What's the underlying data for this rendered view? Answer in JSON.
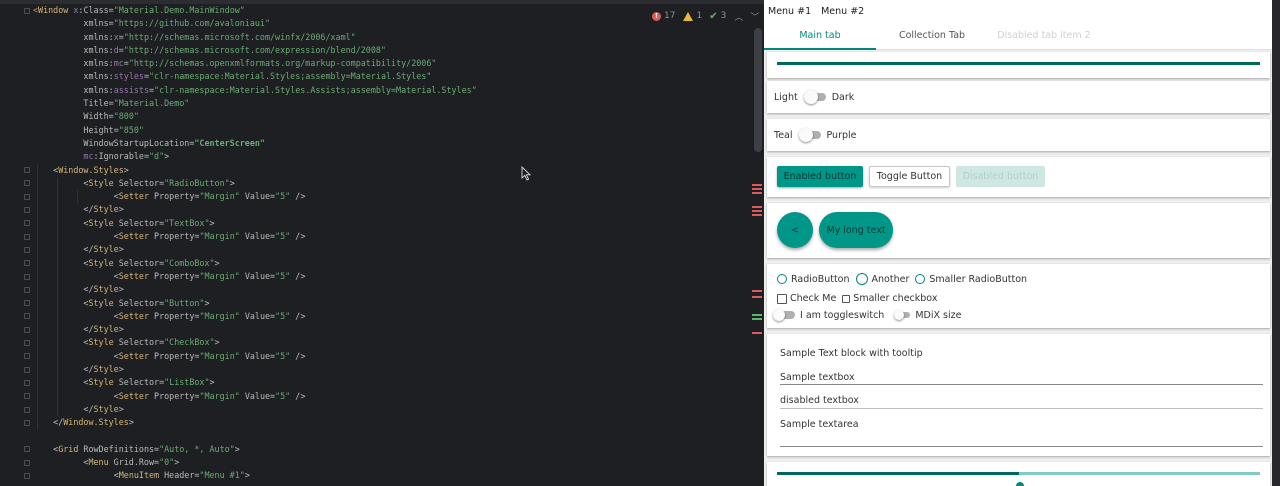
{
  "editor": {
    "inspections": {
      "errors": "17",
      "warnings": "1",
      "ok": "3"
    },
    "code_lines": [
      {
        "indent": 0,
        "parts": [
          [
            "caret",
            "<"
          ],
          [
            "c-tag",
            "Window"
          ],
          [
            "c-ns",
            " x"
          ],
          [
            "c-punc",
            ":"
          ],
          [
            "c-attr",
            "Class"
          ],
          [
            "c-punc",
            "="
          ],
          [
            "c-str",
            "\"Material.Demo.MainWindow\""
          ]
        ]
      },
      {
        "indent": 5,
        "parts": [
          [
            "c-attr",
            "xmlns"
          ],
          [
            "c-punc",
            "="
          ],
          [
            "c-str",
            "\"https://github.com/avaloniaui\""
          ]
        ]
      },
      {
        "indent": 5,
        "parts": [
          [
            "c-attr",
            "xmlns"
          ],
          [
            "c-punc",
            ":"
          ],
          [
            "c-ns",
            "x"
          ],
          [
            "c-punc",
            "="
          ],
          [
            "c-str",
            "\"http://schemas.microsoft.com/winfx/2006/xaml\""
          ]
        ]
      },
      {
        "indent": 5,
        "parts": [
          [
            "c-attr",
            "xmlns"
          ],
          [
            "c-punc",
            ":"
          ],
          [
            "c-ns",
            "d"
          ],
          [
            "c-punc",
            "="
          ],
          [
            "c-str",
            "\"http://schemas.microsoft.com/expression/blend/2008\""
          ]
        ]
      },
      {
        "indent": 5,
        "parts": [
          [
            "c-attr",
            "xmlns"
          ],
          [
            "c-punc",
            ":"
          ],
          [
            "c-ns",
            "mc"
          ],
          [
            "c-punc",
            "="
          ],
          [
            "c-str",
            "\"http://schemas.openxmlformats.org/markup-compatibility/2006\""
          ]
        ]
      },
      {
        "indent": 5,
        "parts": [
          [
            "c-attr",
            "xmlns"
          ],
          [
            "c-punc",
            ":"
          ],
          [
            "c-ns",
            "styles"
          ],
          [
            "c-punc",
            "="
          ],
          [
            "c-str",
            "\"clr-namespace:Material.Styles;assembly=Material.Styles\""
          ]
        ]
      },
      {
        "indent": 5,
        "parts": [
          [
            "c-attr",
            "xmlns"
          ],
          [
            "c-punc",
            ":"
          ],
          [
            "c-ns",
            "assists"
          ],
          [
            "c-punc",
            "="
          ],
          [
            "c-str",
            "\"clr-namespace:Material.Styles.Assists;assembly=Material.Styles\""
          ]
        ]
      },
      {
        "indent": 5,
        "parts": [
          [
            "c-attr",
            "Title"
          ],
          [
            "c-punc",
            "="
          ],
          [
            "c-str",
            "\"Material.Demo\""
          ]
        ]
      },
      {
        "indent": 5,
        "parts": [
          [
            "c-attr",
            "Width"
          ],
          [
            "c-punc",
            "="
          ],
          [
            "c-str",
            "\"800\""
          ]
        ]
      },
      {
        "indent": 5,
        "parts": [
          [
            "c-attr",
            "Height"
          ],
          [
            "c-punc",
            "="
          ],
          [
            "c-str",
            "\"850\""
          ]
        ]
      },
      {
        "indent": 5,
        "parts": [
          [
            "c-attr",
            "WindowStartupLocation"
          ],
          [
            "c-punc",
            "="
          ],
          [
            "c-strb",
            "\"CenterScreen\""
          ]
        ]
      },
      {
        "indent": 5,
        "parts": [
          [
            "c-ns",
            "mc"
          ],
          [
            "c-punc",
            ":"
          ],
          [
            "c-attr",
            "Ignorable"
          ],
          [
            "c-punc",
            "="
          ],
          [
            "c-str",
            "\"d\""
          ],
          [
            "c-punc",
            ">"
          ]
        ]
      },
      {
        "indent": 2,
        "parts": [
          [
            "c-punc",
            "<"
          ],
          [
            "c-tag",
            "Window.Styles"
          ],
          [
            "c-punc",
            ">"
          ]
        ]
      },
      {
        "indent": 5,
        "parts": [
          [
            "c-punc",
            "<"
          ],
          [
            "c-tag",
            "Style"
          ],
          [
            "c-attr",
            " Selector"
          ],
          [
            "c-punc",
            "="
          ],
          [
            "c-str",
            "\"RadioButton\""
          ],
          [
            "c-punc",
            ">"
          ]
        ]
      },
      {
        "indent": 8,
        "parts": [
          [
            "c-punc",
            "<"
          ],
          [
            "c-tag",
            "Setter"
          ],
          [
            "c-attr",
            " Property"
          ],
          [
            "c-punc",
            "="
          ],
          [
            "c-str",
            "\"Margin\""
          ],
          [
            "c-attr",
            " Value"
          ],
          [
            "c-punc",
            "="
          ],
          [
            "c-str",
            "\"5\""
          ],
          [
            "c-punc",
            " />"
          ]
        ]
      },
      {
        "indent": 5,
        "parts": [
          [
            "c-punc",
            "</"
          ],
          [
            "c-tag",
            "Style"
          ],
          [
            "c-punc",
            ">"
          ]
        ]
      },
      {
        "indent": 5,
        "parts": [
          [
            "c-punc",
            "<"
          ],
          [
            "c-tag",
            "Style"
          ],
          [
            "c-attr",
            " Selector"
          ],
          [
            "c-punc",
            "="
          ],
          [
            "c-str",
            "\"TextBox\""
          ],
          [
            "c-punc",
            ">"
          ]
        ]
      },
      {
        "indent": 8,
        "parts": [
          [
            "c-punc",
            "<"
          ],
          [
            "c-tag",
            "Setter"
          ],
          [
            "c-attr",
            " Property"
          ],
          [
            "c-punc",
            "="
          ],
          [
            "c-str",
            "\"Margin\""
          ],
          [
            "c-attr",
            " Value"
          ],
          [
            "c-punc",
            "="
          ],
          [
            "c-str",
            "\"5\""
          ],
          [
            "c-punc",
            " />"
          ]
        ]
      },
      {
        "indent": 5,
        "parts": [
          [
            "c-punc",
            "</"
          ],
          [
            "c-tag",
            "Style"
          ],
          [
            "c-punc",
            ">"
          ]
        ]
      },
      {
        "indent": 5,
        "parts": [
          [
            "c-punc",
            "<"
          ],
          [
            "c-tag",
            "Style"
          ],
          [
            "c-attr",
            " Selector"
          ],
          [
            "c-punc",
            "="
          ],
          [
            "c-str",
            "\"ComboBox\""
          ],
          [
            "c-punc",
            ">"
          ]
        ]
      },
      {
        "indent": 8,
        "parts": [
          [
            "c-punc",
            "<"
          ],
          [
            "c-tag",
            "Setter"
          ],
          [
            "c-attr",
            " Property"
          ],
          [
            "c-punc",
            "="
          ],
          [
            "c-str",
            "\"Margin\""
          ],
          [
            "c-attr",
            " Value"
          ],
          [
            "c-punc",
            "="
          ],
          [
            "c-str",
            "\"5\""
          ],
          [
            "c-punc",
            " />"
          ]
        ]
      },
      {
        "indent": 5,
        "parts": [
          [
            "c-punc",
            "</"
          ],
          [
            "c-tag",
            "Style"
          ],
          [
            "c-punc",
            ">"
          ]
        ]
      },
      {
        "indent": 5,
        "parts": [
          [
            "c-punc",
            "<"
          ],
          [
            "c-tag",
            "Style"
          ],
          [
            "c-attr",
            " Selector"
          ],
          [
            "c-punc",
            "="
          ],
          [
            "c-str",
            "\"Button\""
          ],
          [
            "c-punc",
            ">"
          ]
        ]
      },
      {
        "indent": 8,
        "parts": [
          [
            "c-punc",
            "<"
          ],
          [
            "c-tag",
            "Setter"
          ],
          [
            "c-attr",
            " Property"
          ],
          [
            "c-punc",
            "="
          ],
          [
            "c-str",
            "\"Margin\""
          ],
          [
            "c-attr",
            " Value"
          ],
          [
            "c-punc",
            "="
          ],
          [
            "c-str",
            "\"5\""
          ],
          [
            "c-punc",
            " />"
          ]
        ]
      },
      {
        "indent": 5,
        "parts": [
          [
            "c-punc",
            "</"
          ],
          [
            "c-tag",
            "Style"
          ],
          [
            "c-punc",
            ">"
          ]
        ]
      },
      {
        "indent": 5,
        "parts": [
          [
            "c-punc",
            "<"
          ],
          [
            "c-tag",
            "Style"
          ],
          [
            "c-attr",
            " Selector"
          ],
          [
            "c-punc",
            "="
          ],
          [
            "c-str",
            "\"CheckBox\""
          ],
          [
            "c-punc",
            ">"
          ]
        ]
      },
      {
        "indent": 8,
        "parts": [
          [
            "c-punc",
            "<"
          ],
          [
            "c-tag",
            "Setter"
          ],
          [
            "c-attr",
            " Property"
          ],
          [
            "c-punc",
            "="
          ],
          [
            "c-str",
            "\"Margin\""
          ],
          [
            "c-attr",
            " Value"
          ],
          [
            "c-punc",
            "="
          ],
          [
            "c-str",
            "\"5\""
          ],
          [
            "c-punc",
            " />"
          ]
        ]
      },
      {
        "indent": 5,
        "parts": [
          [
            "c-punc",
            "</"
          ],
          [
            "c-tag",
            "Style"
          ],
          [
            "c-punc",
            ">"
          ]
        ]
      },
      {
        "indent": 5,
        "parts": [
          [
            "c-punc",
            "<"
          ],
          [
            "c-tag",
            "Style"
          ],
          [
            "c-attr",
            " Selector"
          ],
          [
            "c-punc",
            "="
          ],
          [
            "c-str",
            "\"ListBox\""
          ],
          [
            "c-punc",
            ">"
          ]
        ]
      },
      {
        "indent": 8,
        "parts": [
          [
            "c-punc",
            "<"
          ],
          [
            "c-tag",
            "Setter"
          ],
          [
            "c-attr",
            " Property"
          ],
          [
            "c-punc",
            "="
          ],
          [
            "c-str",
            "\"Margin\""
          ],
          [
            "c-attr",
            " Value"
          ],
          [
            "c-punc",
            "="
          ],
          [
            "c-str",
            "\"5\""
          ],
          [
            "c-punc",
            " />"
          ]
        ]
      },
      {
        "indent": 5,
        "parts": [
          [
            "c-punc",
            "</"
          ],
          [
            "c-tag",
            "Style"
          ],
          [
            "c-punc",
            ">"
          ]
        ]
      },
      {
        "indent": 2,
        "parts": [
          [
            "c-punc",
            "</"
          ],
          [
            "c-tag",
            "Window.Styles"
          ],
          [
            "c-punc",
            ">"
          ]
        ]
      },
      {
        "indent": 0,
        "parts": []
      },
      {
        "indent": 2,
        "parts": [
          [
            "c-punc",
            "<"
          ],
          [
            "c-tag",
            "Grid"
          ],
          [
            "c-attr",
            " RowDefinitions"
          ],
          [
            "c-punc",
            "="
          ],
          [
            "c-str",
            "\"Auto, *, Auto\""
          ],
          [
            "c-punc",
            ">"
          ]
        ]
      },
      {
        "indent": 5,
        "parts": [
          [
            "c-punc",
            "<"
          ],
          [
            "c-tag",
            "Menu"
          ],
          [
            "c-attr",
            " Grid.Row"
          ],
          [
            "c-punc",
            "="
          ],
          [
            "c-str",
            "\"0\""
          ],
          [
            "c-punc",
            ">"
          ]
        ]
      },
      {
        "indent": 8,
        "parts": [
          [
            "c-punc",
            "<"
          ],
          [
            "c-tag",
            "MenuItem"
          ],
          [
            "c-attr",
            " Header"
          ],
          [
            "c-punc",
            "="
          ],
          [
            "c-str",
            "\"Menu #1\""
          ],
          [
            "c-punc",
            ">"
          ]
        ]
      }
    ]
  },
  "app": {
    "menu": [
      "Menu #1",
      "Menu #2"
    ],
    "tabs": [
      {
        "label": "Main tab",
        "state": "active"
      },
      {
        "label": "Collection Tab",
        "state": "normal"
      },
      {
        "label": "Disabled tab item 2",
        "state": "disabled"
      }
    ],
    "progress_top": 1.0,
    "theme_toggle": {
      "left": "Light",
      "right": "Dark"
    },
    "color_toggle": {
      "left": "Teal",
      "right": "Purple"
    },
    "buttons": {
      "enabled": "Enabled button",
      "toggle": "Toggle Button",
      "disabled": "Disabled button"
    },
    "fab_small": "<",
    "fab_wide": "My long text",
    "radios": [
      "RadioButton",
      "Another",
      "Smaller RadioButton"
    ],
    "checkboxes": [
      "Check Me",
      "Smaller checkbox"
    ],
    "toggles": [
      "I am toggleswitch",
      "MDiX size"
    ],
    "text": {
      "tooltip_text": "Sample Text block with tooltip",
      "textbox": "Sample textbox",
      "disabled_textbox": "disabled textbox",
      "textarea": "Sample textarea"
    },
    "progress_bottom": 0.5,
    "colors": {
      "accent": "#009688",
      "accent_light": "#80cbc4",
      "accent_dark": "#00695c"
    }
  }
}
